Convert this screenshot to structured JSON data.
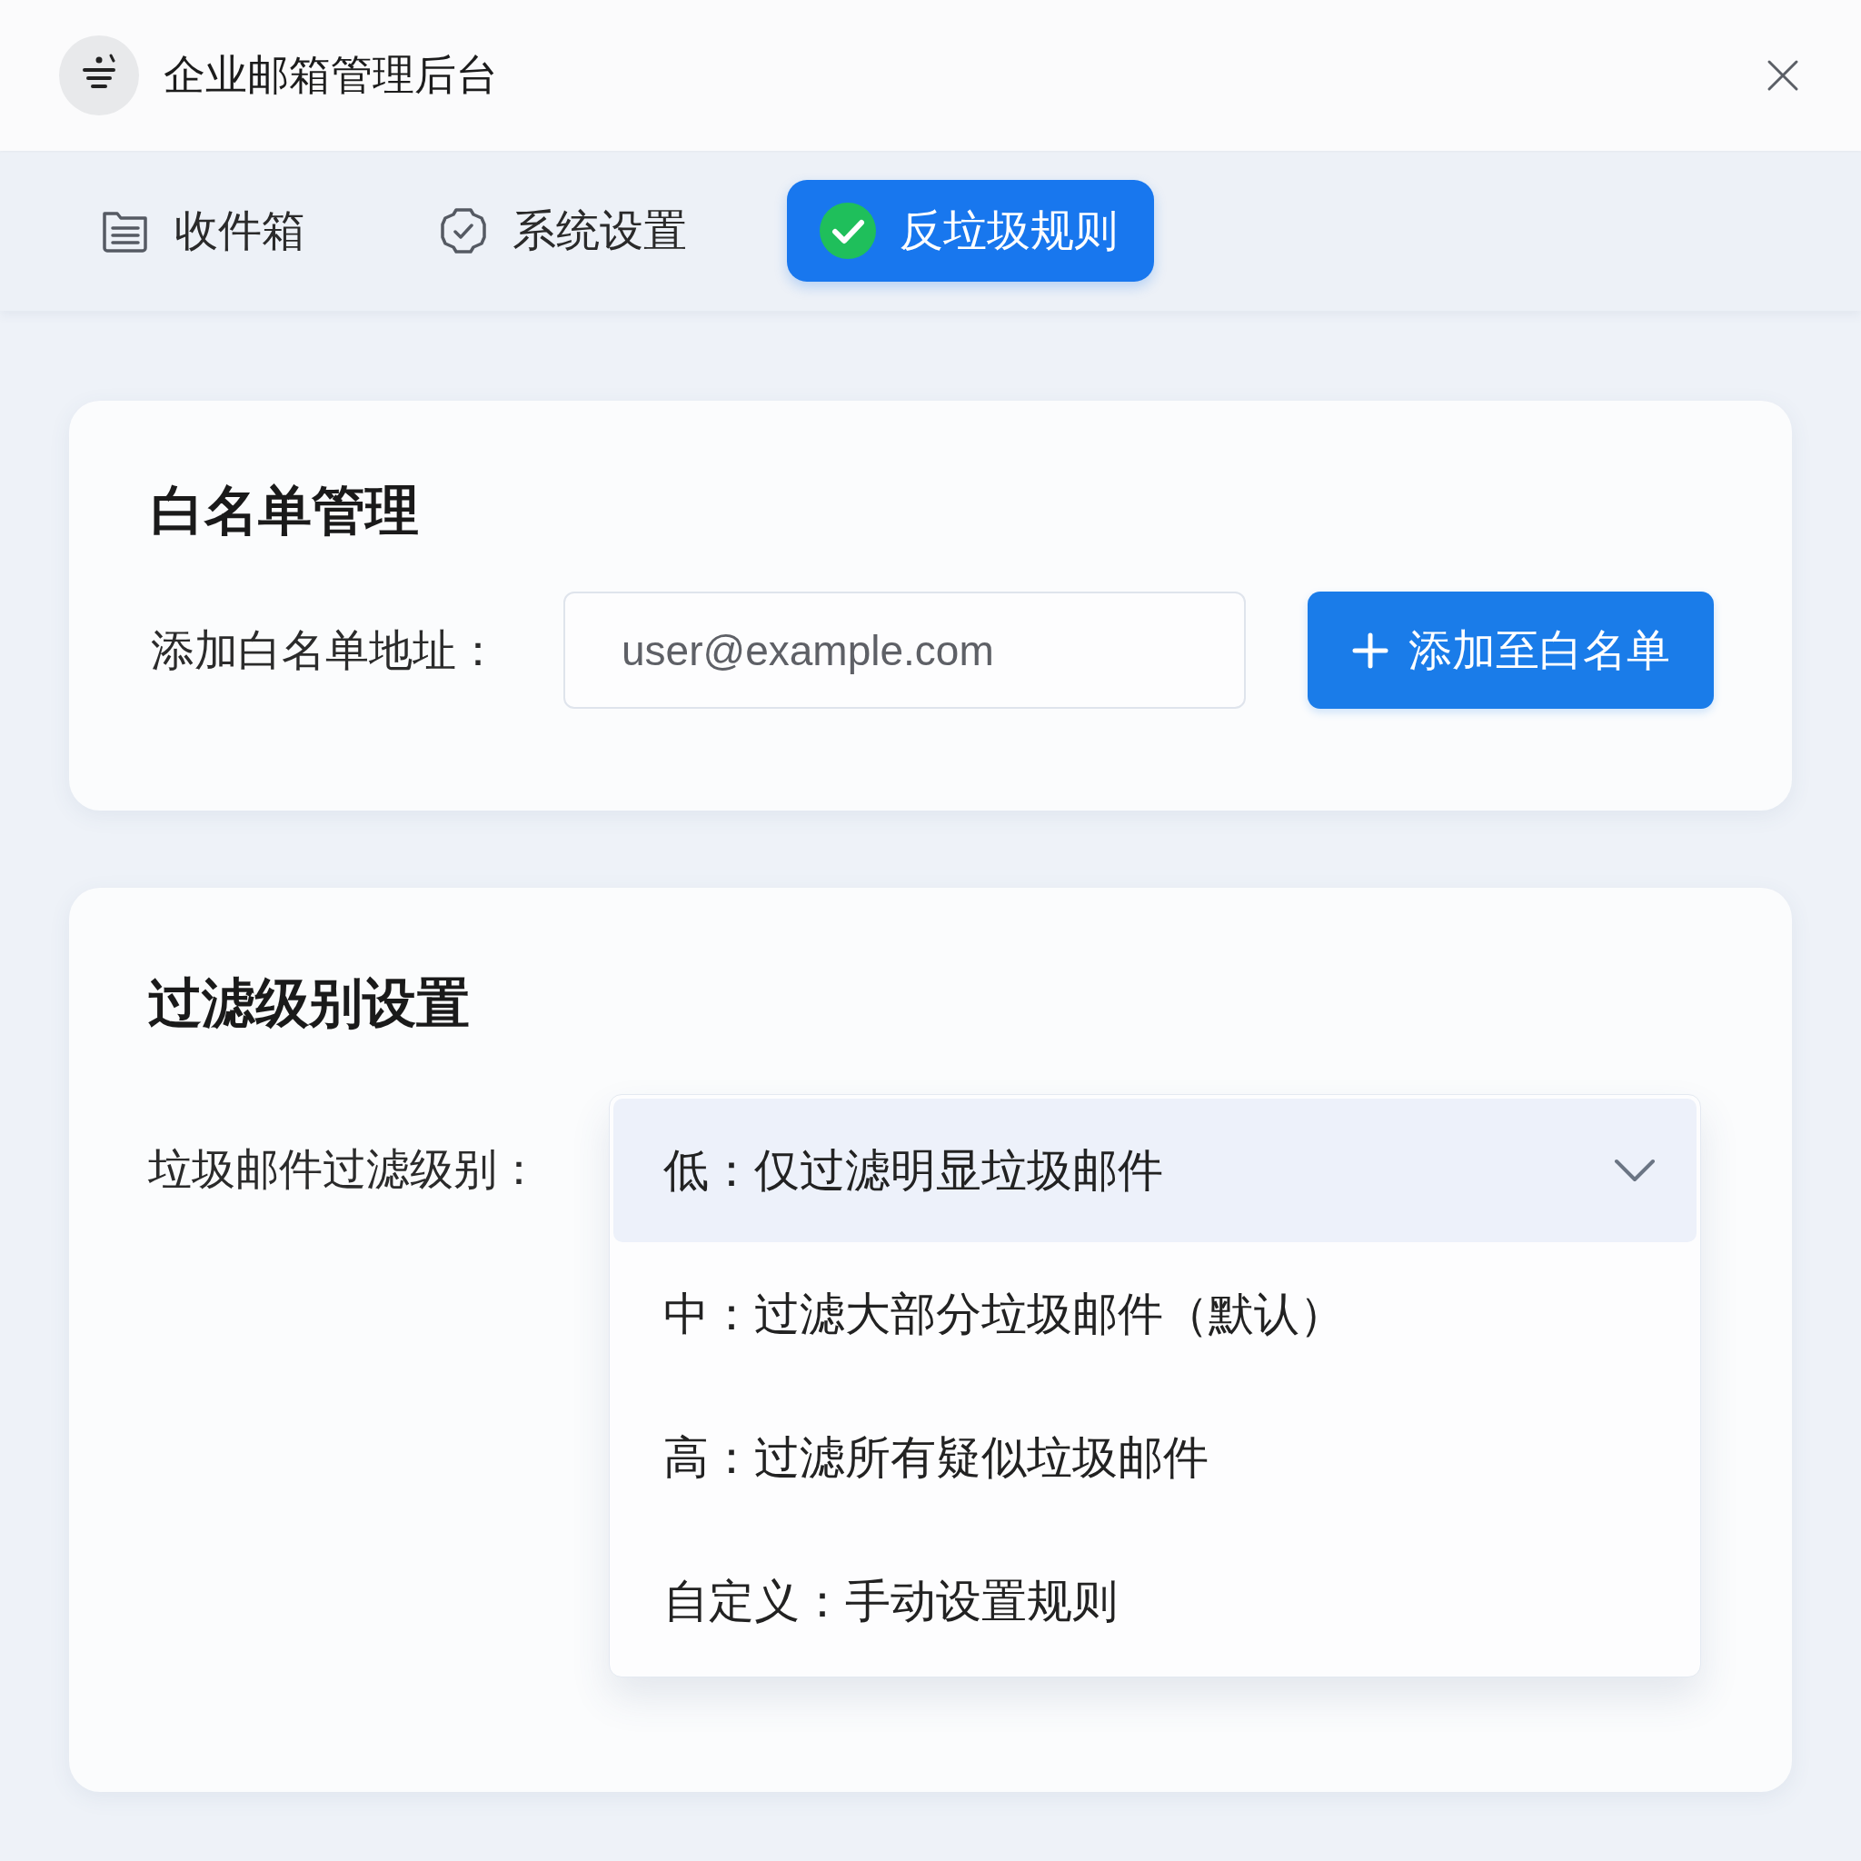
{
  "header": {
    "title": "企业邮箱管理后台"
  },
  "tabs": [
    {
      "label": "收件箱",
      "selected": false
    },
    {
      "label": "系统设置",
      "selected": false
    },
    {
      "label": "反垃圾规则",
      "selected": true
    }
  ],
  "whitelist_card": {
    "title": "白名单管理",
    "label": "添加白名单地址：",
    "input": {
      "placeholder": "user@example.com"
    },
    "button": "添加至白名单"
  },
  "filter_card": {
    "title": "过滤级别设置",
    "label": "垃圾邮件过滤级别：",
    "dropdown": {
      "expanded": true,
      "options": [
        {
          "label": "低：仅过滤明显垃圾邮件",
          "selected": true
        },
        {
          "label": "中：过滤大部分垃圾邮件（默认）",
          "selected": false
        },
        {
          "label": "高：过滤所有疑似垃圾邮件",
          "selected": false
        },
        {
          "label": "自定义：手动设置规则",
          "selected": false
        }
      ]
    }
  }
}
